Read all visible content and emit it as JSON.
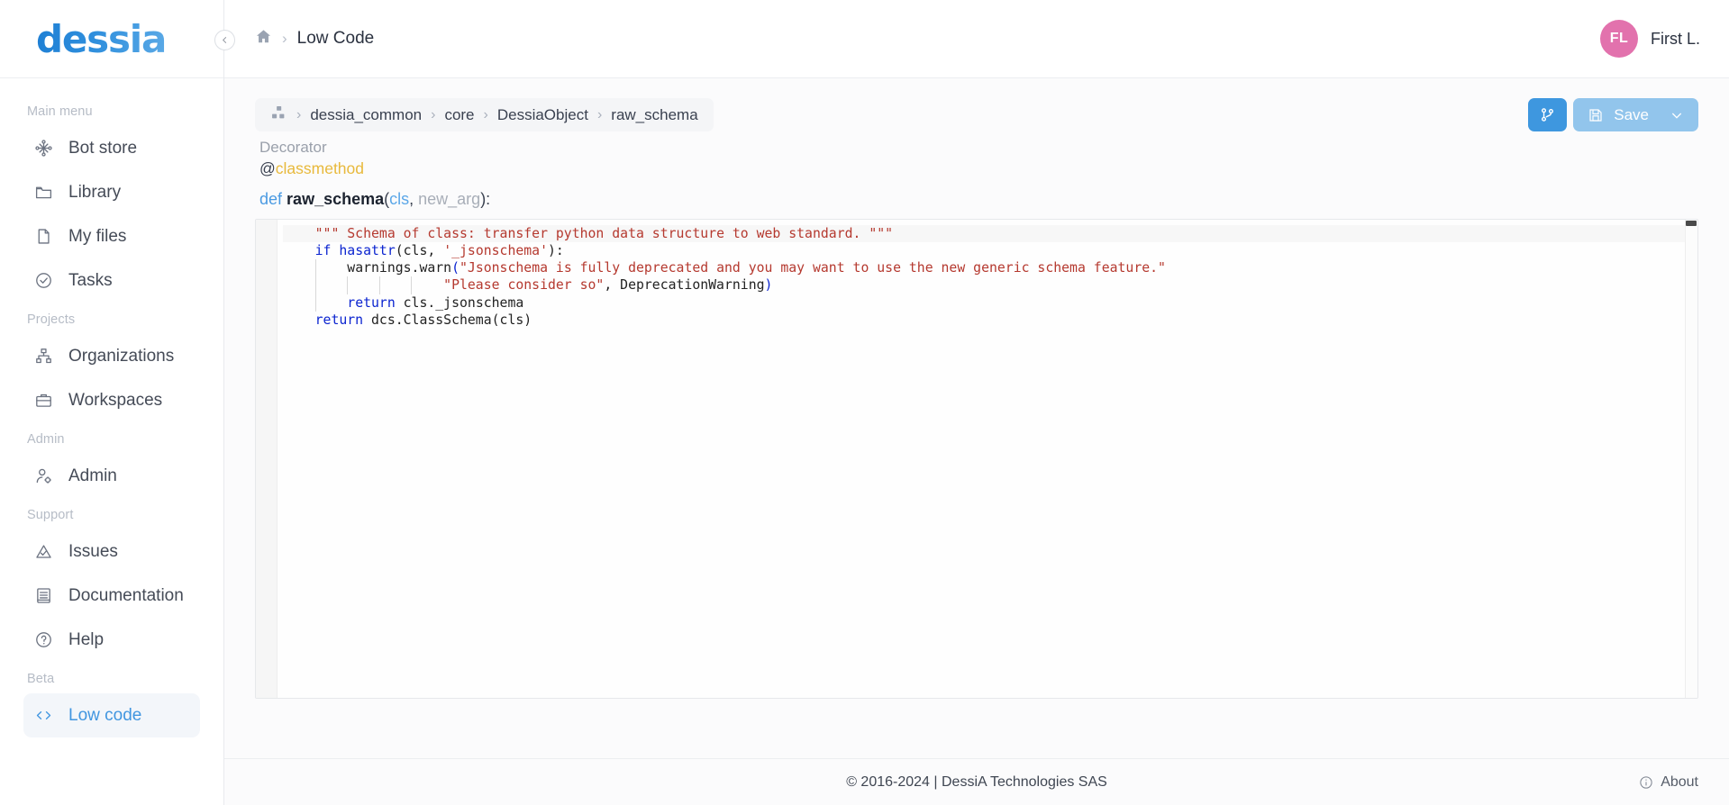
{
  "brand": {
    "logo_text": "dessia"
  },
  "sidebar": {
    "sections": [
      {
        "label": "Main menu",
        "items": [
          {
            "label": "Bot store",
            "icon": "network-nodes-icon",
            "active": false
          },
          {
            "label": "Library",
            "icon": "folder-icon",
            "active": false
          },
          {
            "label": "My files",
            "icon": "file-icon",
            "active": false
          },
          {
            "label": "Tasks",
            "icon": "check-circle-icon",
            "active": false
          }
        ]
      },
      {
        "label": "Projects",
        "items": [
          {
            "label": "Organizations",
            "icon": "sitemap-icon",
            "active": false
          },
          {
            "label": "Workspaces",
            "icon": "briefcase-icon",
            "active": false
          }
        ]
      },
      {
        "label": "Admin",
        "items": [
          {
            "label": "Admin",
            "icon": "user-cog-icon",
            "active": false
          }
        ]
      },
      {
        "label": "Support",
        "items": [
          {
            "label": "Issues",
            "icon": "warning-triangle-icon",
            "active": false
          },
          {
            "label": "Documentation",
            "icon": "book-icon",
            "active": false
          },
          {
            "label": "Help",
            "icon": "question-circle-icon",
            "active": false
          }
        ]
      },
      {
        "label": "Beta",
        "items": [
          {
            "label": "Low code",
            "icon": "code-brackets-icon",
            "active": true
          }
        ]
      }
    ]
  },
  "topbar": {
    "home_icon": "home-icon",
    "separator": "›",
    "page_label": "Low Code",
    "user": {
      "initials": "FL",
      "name": "First L.",
      "avatar_color": "#e272ad"
    }
  },
  "breadcrumb": {
    "icon": "package-cubes-icon",
    "separator": "›",
    "items": [
      "dessia_common",
      "core",
      "DessiaObject",
      "raw_schema"
    ]
  },
  "toolbar": {
    "branch_button": {
      "icon": "git-branch-icon",
      "label": "",
      "color": "#3e97df"
    },
    "save_button": {
      "icon": "floppy-disk-icon",
      "label": "Save",
      "chevron": "chevron-down-icon",
      "color": "#92c5ec"
    }
  },
  "signature": {
    "decorator_label": "Decorator",
    "decorator_at": "@",
    "decorator_name": "classmethod",
    "def_keyword": "def",
    "function_name": "raw_schema",
    "open_paren": "(",
    "arg1": "cls",
    "comma": ", ",
    "arg2": "new_arg",
    "close_paren": "):"
  },
  "editor": {
    "lines": [
      {
        "indent": 1,
        "tokens": [
          {
            "t": "st",
            "v": "\"\"\" Schema of class: transfer python data structure to web standard. \"\"\""
          }
        ],
        "highlight": true
      },
      {
        "indent": 1,
        "tokens": [
          {
            "t": "k",
            "v": "if "
          },
          {
            "t": "f",
            "v": "hasattr"
          },
          {
            "t": "n",
            "v": "(cls, "
          },
          {
            "t": "s",
            "v": "'_jsonschema'"
          },
          {
            "t": "n",
            "v": "):"
          }
        ],
        "highlight": false
      },
      {
        "indent": 2,
        "tokens": [
          {
            "t": "n",
            "v": "warnings.warn"
          },
          {
            "t": "f",
            "v": "("
          },
          {
            "t": "s",
            "v": "\"Jsonschema is fully deprecated and you may want to use the new generic schema feature.\""
          }
        ],
        "highlight": false
      },
      {
        "indent": 5,
        "tokens": [
          {
            "t": "s",
            "v": "\"Please consider so\""
          },
          {
            "t": "n",
            "v": ", DeprecationWarning"
          },
          {
            "t": "f",
            "v": ")"
          }
        ],
        "highlight": false
      },
      {
        "indent": 2,
        "tokens": [
          {
            "t": "k",
            "v": "return "
          },
          {
            "t": "n",
            "v": "cls._jsonschema"
          }
        ],
        "highlight": false
      },
      {
        "indent": 1,
        "tokens": [
          {
            "t": "k",
            "v": "return "
          },
          {
            "t": "n",
            "v": "dcs.ClassSchema(cls)"
          }
        ],
        "highlight": false
      }
    ],
    "scrollbar": {
      "visible": true
    }
  },
  "footer": {
    "copyright": "© 2016-2024 | DessiA Technologies SAS",
    "about_label": "About",
    "about_icon": "info-circle-icon"
  }
}
